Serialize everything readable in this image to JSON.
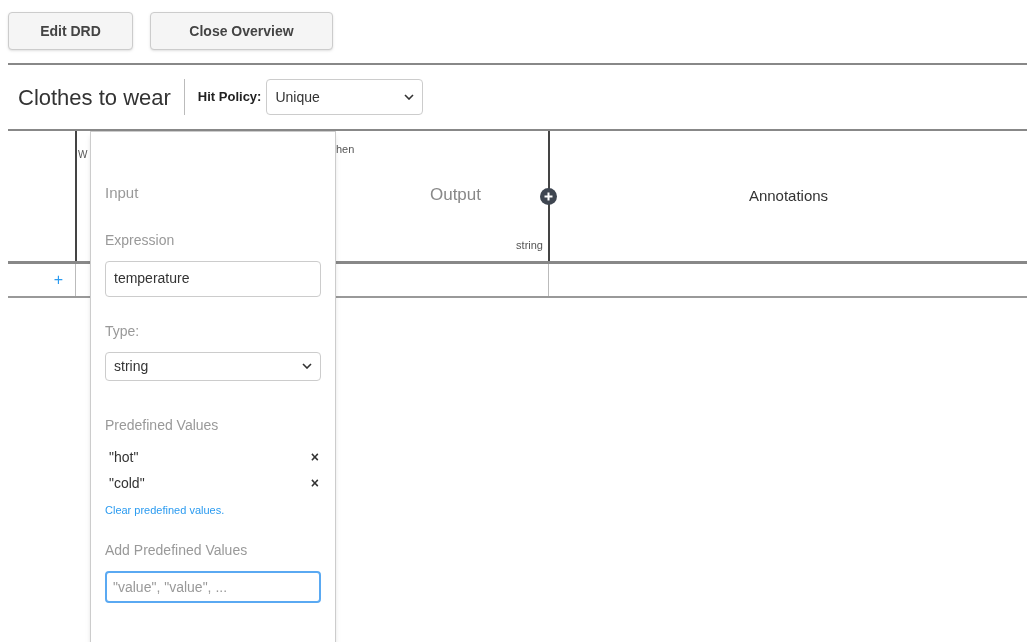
{
  "buttons": [
    {
      "label": "Edit DRD"
    },
    {
      "label": "Close Overview"
    }
  ],
  "table_header": {
    "title": "Clothes to wear",
    "hit_policy": {
      "label": "Hit Policy:",
      "value": "Unique"
    }
  },
  "table": {
    "input_column": {
      "label": "W"
    },
    "output_column": {
      "label": "hen",
      "name": "Output",
      "type": "string"
    },
    "annotations_column": {
      "name": "Annotations"
    },
    "add_row": "+"
  },
  "popup": {
    "title": "Input",
    "expression_label": "Expression",
    "expression_value": "temperature",
    "type_label": "Type:",
    "type_value": "string",
    "predefined_label": "Predefined Values",
    "predefined_values": [
      {
        "value": "\"hot\"",
        "remove": "×"
      },
      {
        "value": "\"cold\"",
        "remove": "×"
      }
    ],
    "clear_link": "Clear predefined values.",
    "add_label": "Add Predefined Values",
    "add_placeholder": "\"value\", \"value\", ...",
    "add_focused": true
  }
}
